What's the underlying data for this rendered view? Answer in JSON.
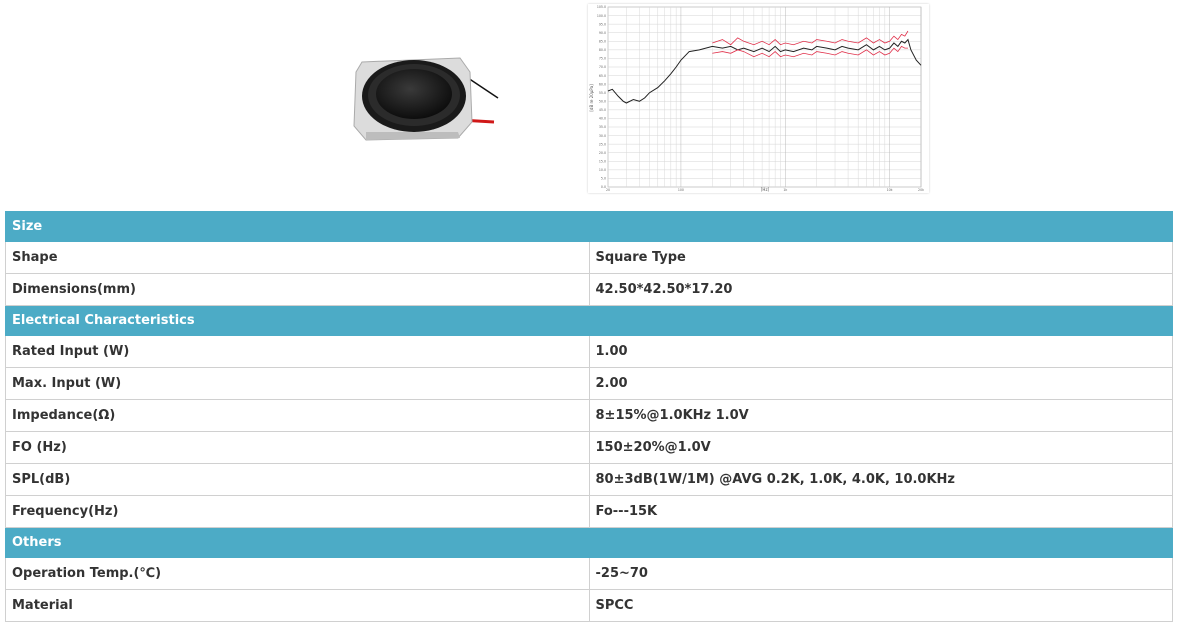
{
  "sections": [
    {
      "title": "Size",
      "rows": [
        {
          "label": "Shape",
          "value": "Square Type"
        },
        {
          "label": "Dimensions(mm)",
          "value": "42.50*42.50*17.20"
        }
      ]
    },
    {
      "title": "Electrical Characteristics",
      "rows": [
        {
          "label": "Rated Input (W)",
          "value": "1.00"
        },
        {
          "label": "Max. Input (W)",
          "value": "2.00"
        },
        {
          "label": "Impedance(Ω)",
          "value": "8±15%@1.0KHz 1.0V"
        },
        {
          "label": "FO (Hz)",
          "value": "150±20%@1.0V"
        },
        {
          "label": "SPL(dB)",
          "value": "80±3dB(1W/1M) @AVG 0.2K, 1.0K, 4.0K, 10.0KHz"
        },
        {
          "label": "Frequency(Hz)",
          "value": "Fo---15K"
        }
      ]
    },
    {
      "title": "Others",
      "rows": [
        {
          "label": "Operation Temp.(℃)",
          "value": "-25~70"
        },
        {
          "label": "Material",
          "value": "SPCC"
        }
      ]
    }
  ],
  "chart_data": {
    "type": "line",
    "xlabel": "[Hz]",
    "ylabel": "[dB re 20µPa]",
    "xscale": "log",
    "xlim": [
      20,
      20000
    ],
    "ylim": [
      0,
      105
    ],
    "xticks": [
      "20",
      "100",
      "1k",
      "10k",
      "20k"
    ],
    "yticks": [
      "0.0",
      "5.0",
      "10.0",
      "15.0",
      "20.0",
      "25.0",
      "30.0",
      "35.0",
      "40.0",
      "45.0",
      "50.0",
      "55.0",
      "60.0",
      "65.0",
      "70.0",
      "75.0",
      "80.0",
      "85.0",
      "90.0",
      "95.0",
      "100.0",
      "105.0"
    ],
    "grid": true,
    "colors": {
      "response": "#222222",
      "limits": "#e0304a"
    },
    "series": [
      {
        "x": [
          20,
          22,
          25,
          28,
          30,
          35,
          40,
          45,
          50,
          60,
          70,
          80,
          90,
          100,
          120,
          150,
          200,
          250,
          300,
          350,
          400,
          500,
          600,
          700,
          800,
          900,
          1000,
          1200,
          1500,
          1800,
          2000,
          2500,
          3000,
          3500,
          4000,
          5000,
          6000,
          7000,
          8000,
          9000,
          10000,
          11000,
          12000,
          13000,
          14000,
          15000,
          16000,
          18000,
          20000
        ],
        "y": [
          56,
          57,
          53,
          50,
          49,
          51,
          50,
          52,
          55,
          58,
          62,
          66,
          70,
          74,
          79,
          80,
          82,
          81,
          82,
          80,
          81,
          79,
          81,
          79,
          82,
          79,
          80,
          79,
          81,
          80,
          82,
          81,
          80,
          82,
          81,
          80,
          83,
          80,
          82,
          80,
          81,
          84,
          82,
          85,
          84,
          86,
          80,
          74,
          71
        ]
      },
      {
        "x": [
          200,
          250,
          300,
          350,
          400,
          500,
          600,
          700,
          800,
          900,
          1000,
          1200,
          1500,
          1800,
          2000,
          2500,
          3000,
          3500,
          4000,
          5000,
          6000,
          7000,
          8000,
          9000,
          10000,
          11000,
          12000,
          13000,
          14000,
          15000
        ],
        "y": [
          84,
          86,
          83,
          87,
          85,
          83,
          85,
          83,
          86,
          83,
          84,
          83,
          85,
          84,
          86,
          85,
          84,
          86,
          85,
          84,
          87,
          84,
          86,
          84,
          85,
          88,
          86,
          89,
          88,
          91
        ]
      },
      {
        "x": [
          200,
          250,
          300,
          350,
          400,
          500,
          600,
          700,
          800,
          900,
          1000,
          1200,
          1500,
          1800,
          2000,
          2500,
          3000,
          3500,
          4000,
          5000,
          6000,
          7000,
          8000,
          9000,
          10000,
          11000,
          12000,
          13000,
          14000,
          15000
        ],
        "y": [
          78,
          79,
          78,
          80,
          79,
          76,
          78,
          76,
          79,
          76,
          77,
          76,
          78,
          77,
          79,
          78,
          77,
          79,
          78,
          77,
          80,
          77,
          79,
          77,
          78,
          81,
          79,
          82,
          81,
          81
        ]
      }
    ]
  }
}
